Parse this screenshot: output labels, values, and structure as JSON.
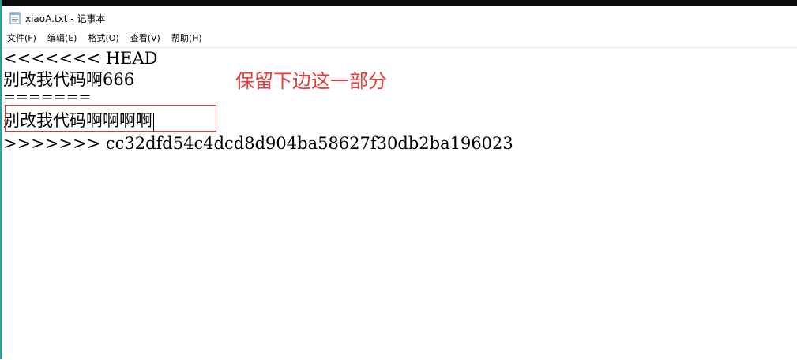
{
  "window": {
    "title": "xiaoA.txt - 记事本",
    "icon": "notepad-icon"
  },
  "menu": {
    "items": [
      {
        "label": "文件(F)"
      },
      {
        "label": "编辑(E)"
      },
      {
        "label": "格式(O)"
      },
      {
        "label": "查看(V)"
      },
      {
        "label": "帮助(H)"
      }
    ]
  },
  "editor": {
    "lines": [
      "<<<<<<< HEAD",
      "别改我代码啊666",
      "=======",
      "别改我代码啊啊啊啊",
      ">>>>>>> cc32dfd54c4dcd8d904ba58627f30db2ba196023"
    ],
    "annotation": "保留下边这一部分"
  },
  "colors": {
    "annotation": "#e83a3a",
    "highlight_border": "#d23a3a",
    "window_border": "#1aa3a3"
  }
}
